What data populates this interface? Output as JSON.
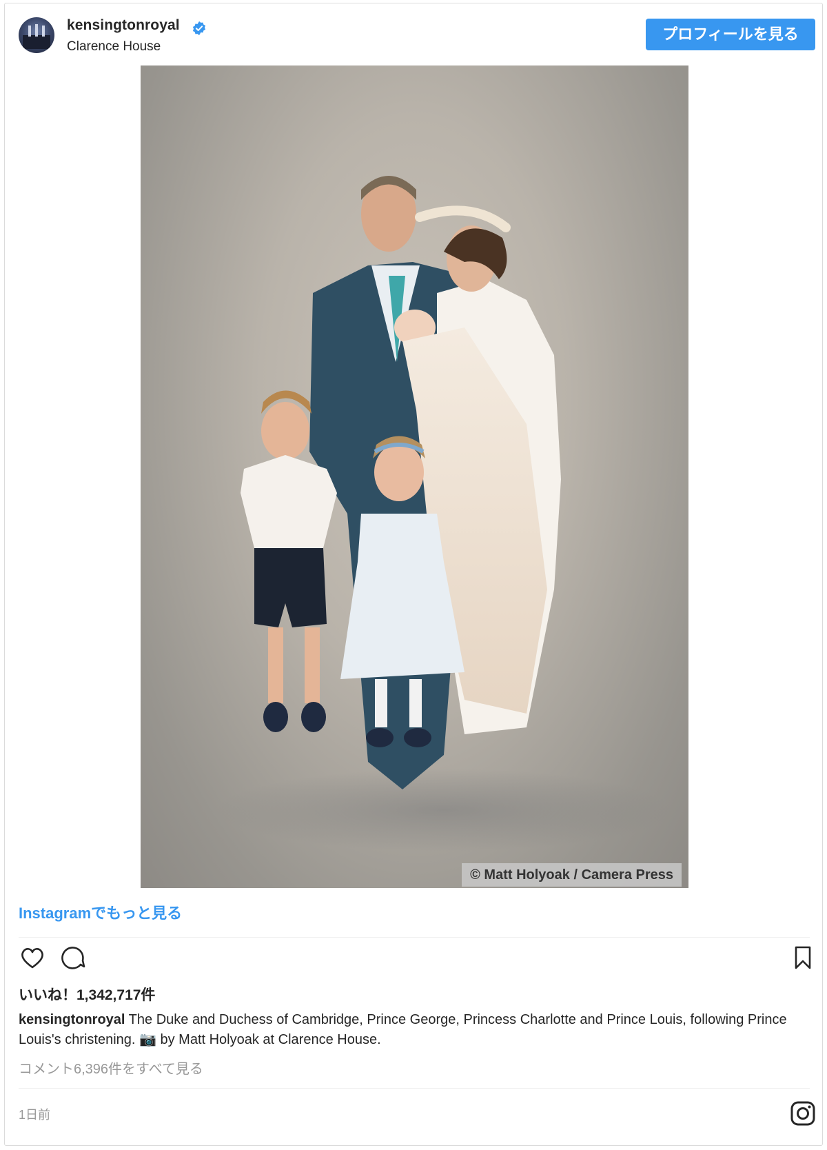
{
  "header": {
    "username": "kensingtonroyal",
    "location": "Clarence House",
    "profile_button": "プロフィールを見る",
    "verified_icon": "verified-badge-icon"
  },
  "photo": {
    "credit": "© Matt Holyoak / Camera Press"
  },
  "more_link": "Instagramでもっと見る",
  "actions": {
    "like_icon": "heart-icon",
    "comment_icon": "comment-icon",
    "save_icon": "bookmark-icon"
  },
  "likes": "いいね！1,342,717件",
  "caption": {
    "user": "kensingtonroyal",
    "text": " The Duke and Duchess of Cambridge, Prince George, Princess Charlotte and Prince Louis, following Prince Louis's christening. 📷 by Matt Holyoak at Clarence House."
  },
  "comments_link": "コメント6,396件をすべて見る",
  "time": "1日前",
  "footer_icon": "instagram-logo-icon",
  "colors": {
    "accent": "#3897f0",
    "text": "#262626",
    "muted": "#999999"
  }
}
